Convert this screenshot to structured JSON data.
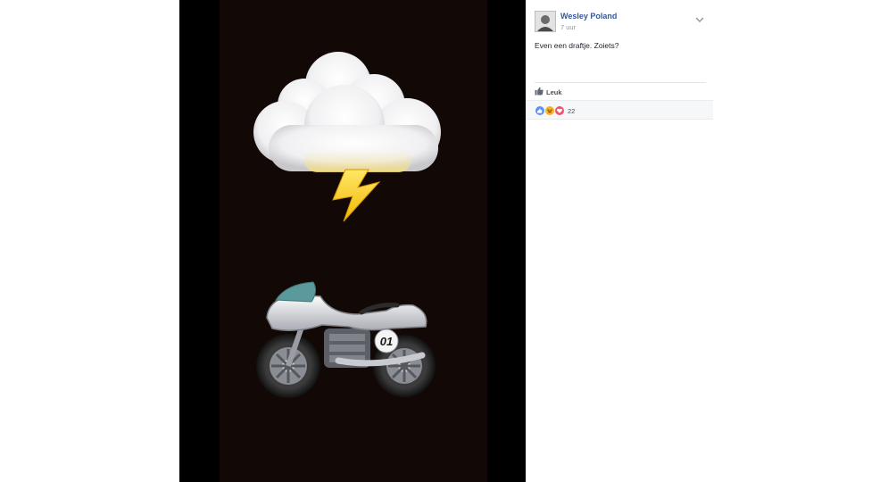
{
  "post": {
    "author": "Wesley Poland",
    "time": "7 uur",
    "text": "Even een draftje. Zoiets?"
  },
  "actions": {
    "like_label": "Leuk"
  },
  "reactions": {
    "count": "22",
    "types": [
      "like-icon",
      "haha-icon",
      "love-icon"
    ],
    "colors": {
      "like": "#5890ff",
      "haha": "#f7b125",
      "love": "#f25268"
    }
  },
  "media": {
    "emojis": [
      "cloud-with-lightning-icon",
      "racing-motorcycle-icon"
    ],
    "race_number": "01"
  },
  "colors": {
    "link": "#365899",
    "meta": "#90949c",
    "media_bg": "#120806"
  }
}
